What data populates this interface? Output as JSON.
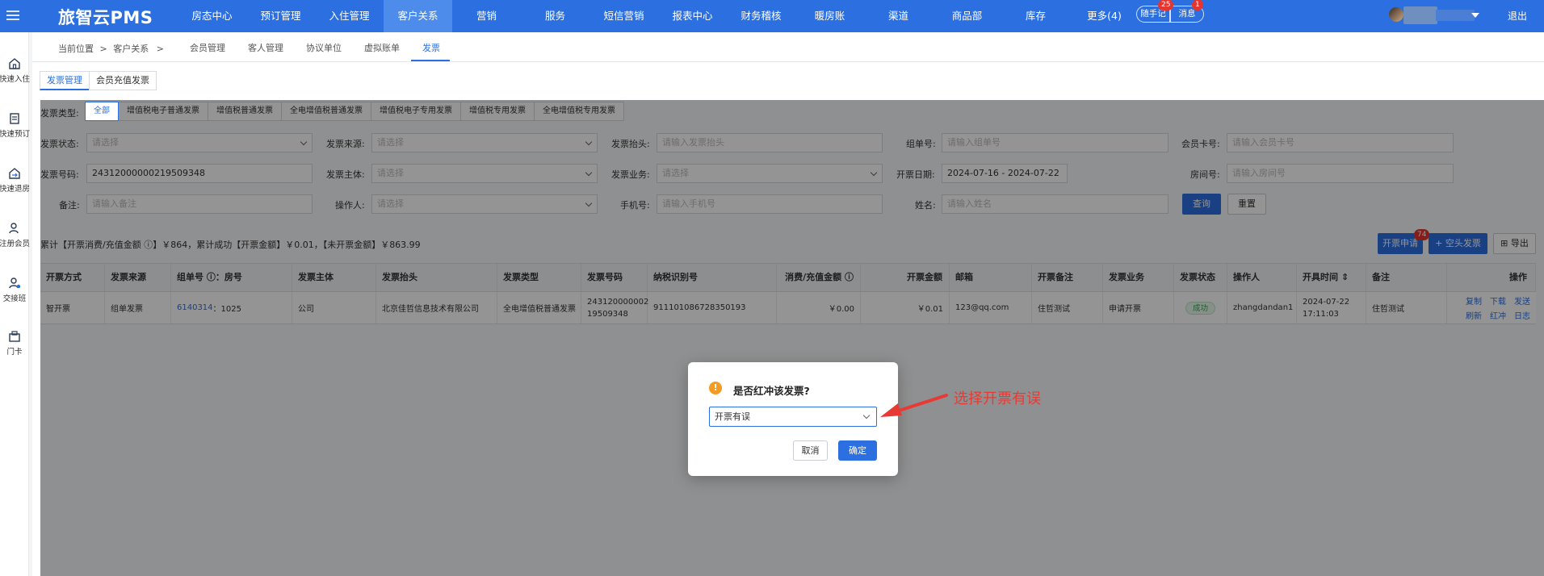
{
  "app": {
    "logo": "旅智云PMS"
  },
  "topnav": [
    {
      "label": "房态中心",
      "active": false
    },
    {
      "label": "预订管理",
      "active": false
    },
    {
      "label": "入住管理",
      "active": false
    },
    {
      "label": "客户关系",
      "active": true
    },
    {
      "label": "营销",
      "active": false
    },
    {
      "label": "服务",
      "active": false
    },
    {
      "label": "短信营销",
      "active": false
    },
    {
      "label": "报表中心",
      "active": false
    },
    {
      "label": "财务稽核",
      "active": false
    },
    {
      "label": "暖房账",
      "active": false
    },
    {
      "label": "渠道",
      "active": false
    },
    {
      "label": "商品部",
      "active": false
    },
    {
      "label": "库存",
      "active": false
    },
    {
      "label": "更多(4)",
      "active": false
    }
  ],
  "header": {
    "notes_label": "随手记",
    "notes_badge": "25",
    "messages_label": "消息",
    "messages_badge": "1",
    "logout": "退出"
  },
  "sidebar": [
    {
      "label": "快速入住",
      "icon": "home-icon"
    },
    {
      "label": "快速预订",
      "icon": "document-icon"
    },
    {
      "label": "快速退房",
      "icon": "checkout-icon"
    },
    {
      "label": "注册会员",
      "icon": "user-add-icon"
    },
    {
      "label": "交接班",
      "icon": "shift-handover-icon"
    },
    {
      "label": "门卡",
      "icon": "keycard-icon"
    }
  ],
  "breadcrumb": {
    "prefix": "当前位置",
    "sep": ">",
    "item": "客户关系",
    "sep2": ">"
  },
  "subtabs": [
    {
      "label": "会员管理"
    },
    {
      "label": "客人管理"
    },
    {
      "label": "协议单位"
    },
    {
      "label": "虚拟账单"
    },
    {
      "label": "发票",
      "active": true
    }
  ],
  "content_tabs": [
    {
      "label": "发票管理",
      "active": true
    },
    {
      "label": "会员充值发票",
      "active": false
    }
  ],
  "filters": {
    "type_label": "发票类型:",
    "types": [
      "全部",
      "增值税电子普通发票",
      "增值税普通发票",
      "全电增值税普通发票",
      "增值税电子专用发票",
      "增值税专用发票",
      "全电增值税专用发票"
    ],
    "status_label": "发票状态:",
    "status_placeholder": "请选择",
    "source_label": "发票来源:",
    "source_placeholder": "请选择",
    "title_label": "发票抬头:",
    "title_placeholder": "请输入发票抬头",
    "group_label": "组单号:",
    "group_placeholder": "请输入组单号",
    "card_label": "会员卡号:",
    "card_placeholder": "请输入会员卡号",
    "number_label": "发票号码:",
    "number_value": "24312000000219509348",
    "entity_label": "发票主体:",
    "entity_placeholder": "请选择",
    "business_label": "发票业务:",
    "business_placeholder": "请选择",
    "date_label": "开票日期:",
    "date_value": "2024-07-16 - 2024-07-22",
    "room_label": "房间号:",
    "room_placeholder": "请输入房间号",
    "remark_label": "备注:",
    "remark_placeholder": "请输入备注",
    "operator_label": "操作人:",
    "operator_placeholder": "请选择",
    "phone_label": "手机号:",
    "phone_placeholder": "请输入手机号",
    "name_label": "姓名:",
    "name_placeholder": "请输入姓名",
    "query": "查询",
    "reset": "重置"
  },
  "summary": "累计【开票消费/充值金额 ⓘ】￥864，累计成功【开票金额】￥0.01，【未开票金额】￥863.99",
  "actions": {
    "apply": "开票申请",
    "apply_badge": "74",
    "blank": "+ 空头发票",
    "export": "⊞ 导出"
  },
  "table": {
    "headers": [
      "开票方式",
      "发票来源",
      "组单号 ⓘ：房号",
      "发票主体",
      "发票抬头",
      "发票类型",
      "发票号码",
      "纳税识别号",
      "消费/充值金额 ⓘ",
      "开票金额",
      "邮箱",
      "开票备注",
      "发票业务",
      "发票状态",
      "操作人",
      "开具时间 ⇕",
      "备注",
      "操作"
    ],
    "row": {
      "method": "智开票",
      "source": "组单发票",
      "group_link": "6140314",
      "room": "：1025",
      "entity": "公司",
      "title": "北京佳哲信息技术有限公司",
      "type": "全电增值税普通发票",
      "number_line1": "243120000002",
      "number_line2": "19509348",
      "tax_id": "911101086728350193",
      "consume": "￥0.00",
      "amount": "￥0.01",
      "email": "123@qq.com",
      "note": "住哲测试",
      "business": "申请开票",
      "status": "成功",
      "operator": "zhangdandan1",
      "time_line1": "2024-07-22",
      "time_line2": "17:11:03",
      "remark": "住哲测试",
      "ops": [
        "复制",
        "下载",
        "发送",
        "刷新",
        "红冲",
        "日志"
      ]
    }
  },
  "dialog": {
    "title": "是否红冲该发票?",
    "select_value": "开票有误",
    "cancel": "取消",
    "ok": "确定"
  },
  "annotation": "选择开票有误",
  "colors": {
    "primary": "#2b6fe0",
    "warning": "#f59a23",
    "annotation": "#e83a34"
  }
}
